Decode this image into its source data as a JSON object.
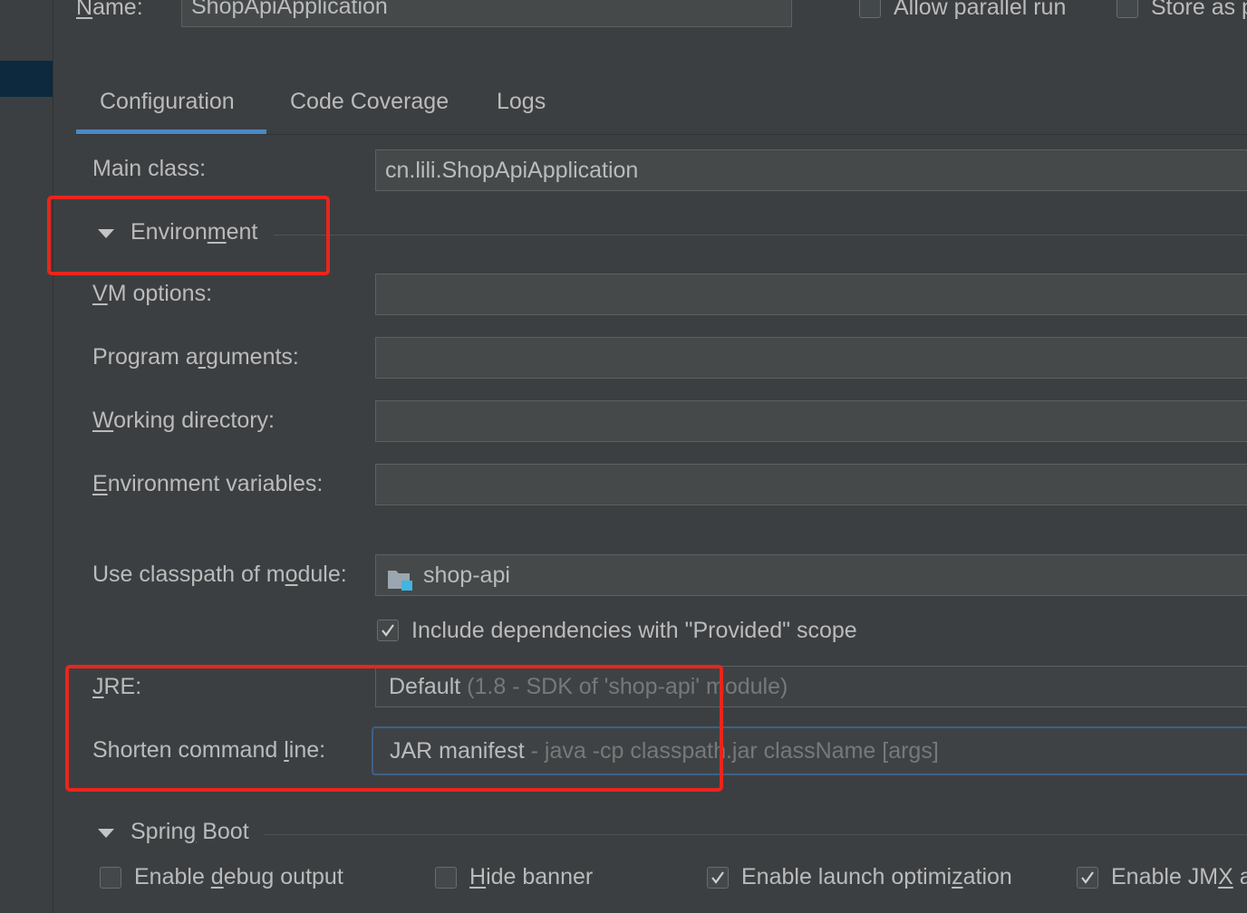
{
  "header": {
    "name_label": "Name:",
    "name_value": "ShopApiApplication",
    "allow_parallel_label": "Allow parallel run",
    "allow_parallel_checked": false,
    "store_as_label": "Store as p",
    "store_as_checked": false
  },
  "tabs": [
    {
      "label": "Configuration",
      "active": true
    },
    {
      "label": "Code Coverage",
      "active": false
    },
    {
      "label": "Logs",
      "active": false
    }
  ],
  "form": {
    "main_class_label": "Main class:",
    "main_class_value": "cn.lili.ShopApiApplication",
    "environment_section": "Environment",
    "vm_options_label": "VM options:",
    "vm_options_value": "",
    "program_args_label": "Program arguments:",
    "program_args_value": "",
    "working_dir_label": "Working directory:",
    "working_dir_value": "",
    "env_vars_label": "Environment variables:",
    "env_vars_value": "",
    "module_label": "Use classpath of module:",
    "module_value": "shop-api",
    "include_deps_label": "Include dependencies with \"Provided\" scope",
    "include_deps_checked": true,
    "jre_label": "JRE:",
    "jre_value": "Default",
    "jre_hint": " (1.8 - SDK of 'shop-api' module)",
    "shorten_label": "Shorten command line:",
    "shorten_value": "JAR manifest",
    "shorten_hint": " - java -cp classpath.jar className [args]"
  },
  "spring_boot": {
    "section_label": "Spring Boot",
    "debug_output_label": "Enable debug output",
    "debug_output_checked": false,
    "hide_banner_label": "Hide banner",
    "hide_banner_checked": false,
    "launch_opt_label": "Enable launch optimization",
    "launch_opt_checked": true,
    "jmx_label": "Enable JMX a",
    "jmx_checked": true
  },
  "colors": {
    "background": "#3c3f41",
    "field": "#45494a",
    "accent": "#4a88c7",
    "highlight": "#e8261d",
    "text": "#bbbbbb"
  }
}
